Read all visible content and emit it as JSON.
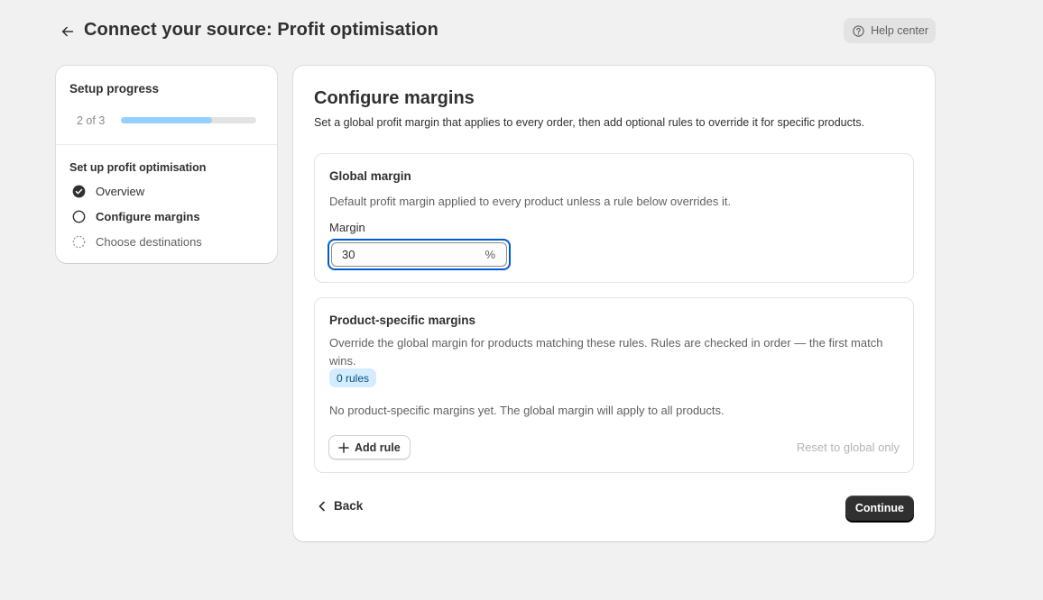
{
  "header": {
    "title": "Connect your source: Profit optimisation",
    "help_label": "Help center"
  },
  "progress": {
    "title": "Setup progress",
    "count": "2 of 3",
    "fraction": 0.67,
    "section_title": "Set up profit optimisation",
    "steps": [
      {
        "label": "Overview",
        "status": "complete"
      },
      {
        "label": "Configure margins",
        "status": "current"
      },
      {
        "label": "Choose destinations",
        "status": "pending"
      }
    ]
  },
  "main": {
    "title": "Configure margins",
    "description": "Set a global profit margin that applies to every order, then add optional rules to override it for specific products.",
    "global": {
      "title": "Global margin",
      "description": "Default profit margin applied to every product unless a rule below overrides it.",
      "field_label": "Margin",
      "value": "30",
      "suffix": "%"
    },
    "product": {
      "title": "Product-specific margins",
      "description": "Override the global margin for products matching these rules. Rules are checked in order — the first match wins.",
      "badge": "0 rules",
      "empty_text": "No product-specific margins yet. The global margin will apply to all products.",
      "add_label": "Add rule",
      "reset_label": "Reset to global only"
    },
    "back_label": "Back",
    "continue_label": "Continue"
  },
  "colors": {
    "accent_focus": "#005bd3",
    "progress_fill": "#91d0ff",
    "badge_bg": "#d5ebff",
    "primary_button": "#303030"
  }
}
